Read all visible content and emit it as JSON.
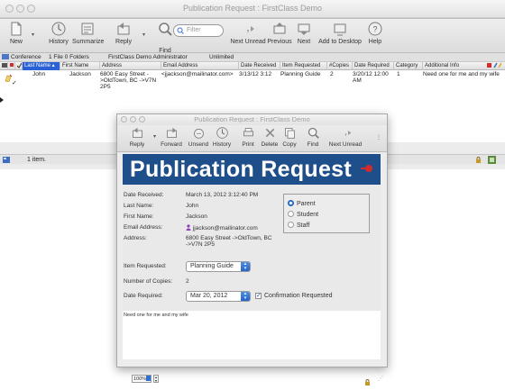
{
  "main_window": {
    "title": "Publication Request : FirstClass Demo",
    "toolbar": [
      {
        "id": "new",
        "label": "New",
        "icon": "new-document-icon"
      },
      {
        "id": "history",
        "label": "History",
        "icon": "history-icon"
      },
      {
        "id": "summarize",
        "label": "Summarize",
        "icon": "summarize-icon"
      },
      {
        "id": "reply",
        "label": "Reply",
        "icon": "reply-icon"
      },
      {
        "id": "find",
        "label": "Find",
        "icon": "magnifier-icon"
      },
      {
        "id": "next-unread",
        "label": "Next Unread",
        "icon": "next-unread-icon"
      },
      {
        "id": "previous",
        "label": "Previous",
        "icon": "previous-icon"
      },
      {
        "id": "next",
        "label": "Next",
        "icon": "next-icon"
      },
      {
        "id": "add-to-desktop",
        "label": "Add to Desktop",
        "icon": "add-to-desktop-icon"
      },
      {
        "id": "help",
        "label": "Help",
        "icon": "help-icon"
      }
    ],
    "filter_placeholder": "Filter",
    "pathbar": {
      "conference": "Conference",
      "counts": "1 File  0 Folders",
      "user": "FirstClass Demo  Administrator",
      "quota": "Unlimited"
    },
    "columns": [
      "Last Name",
      "First Name",
      "Address",
      "Email Address",
      "Date Received",
      "Item Requested",
      "#Copies",
      "Date Required",
      "Category",
      "Additional Info"
    ],
    "rows": [
      {
        "last_name": "John",
        "first_name": "Jackson",
        "address": "6800 Easy Street - >OldTown, BC ->V7N 2P5",
        "email": "<jjackson@mailinator.com>",
        "date_received": "3/13/12 3:12",
        "item_requested": "Planning Guide",
        "copies": "2",
        "date_required": "3/20/12 12:00 AM",
        "category": "1",
        "additional_info": "Need one for me and my wife"
      }
    ],
    "status": "1 item."
  },
  "document_window": {
    "title": "Publication Request : FirstClass Demo",
    "toolbar": [
      {
        "id": "reply",
        "label": "Reply",
        "icon": "reply-icon"
      },
      {
        "id": "forward",
        "label": "Forward",
        "icon": "forward-icon"
      },
      {
        "id": "unsend",
        "label": "Unsend",
        "icon": "unsend-icon"
      },
      {
        "id": "history",
        "label": "History",
        "icon": "history-icon"
      },
      {
        "id": "print",
        "label": "Print",
        "icon": "print-icon"
      },
      {
        "id": "delete",
        "label": "Delete",
        "icon": "delete-icon"
      },
      {
        "id": "copy",
        "label": "Copy",
        "icon": "copy-icon"
      },
      {
        "id": "find",
        "label": "Find",
        "icon": "magnifier-icon"
      },
      {
        "id": "next-unread",
        "label": "Next Unread",
        "icon": "next-unread-icon"
      }
    ],
    "banner": "Publication Request",
    "form": {
      "date_received_label": "Date Received:",
      "date_received": "March 13, 2012 3:12:40 PM",
      "last_name_label": "Last Name:",
      "last_name": "John",
      "first_name_label": "First  Name:",
      "first_name": "Jackson",
      "email_label": "Email Address:",
      "email": "jjackson@mailinator.com",
      "address_label": "Address:",
      "address_line1": "6800 Easy Street ->OldTown, BC",
      "address_line2": "->V7N 2P5",
      "item_requested_label": "Item Requested:",
      "item_requested": "Planning Guide",
      "copies_label": "Number of Copies:",
      "copies": "2",
      "date_required_label": "Date Required:",
      "date_required": "Mar 20, 2012",
      "confirmation_label": "Confirmation Requested",
      "confirmation_checked": true,
      "radio_options": [
        {
          "label": "Parent",
          "selected": true
        },
        {
          "label": "Student",
          "selected": false
        },
        {
          "label": "Staff",
          "selected": false
        }
      ]
    },
    "body_text": "Need one for me and my wife",
    "zoom": "100%"
  },
  "colors": {
    "banner_bg": "#1f4f8a",
    "selected_column": "#2a61d6",
    "accent_blue": "#2d79de",
    "flag_red": "#d12b2b"
  }
}
